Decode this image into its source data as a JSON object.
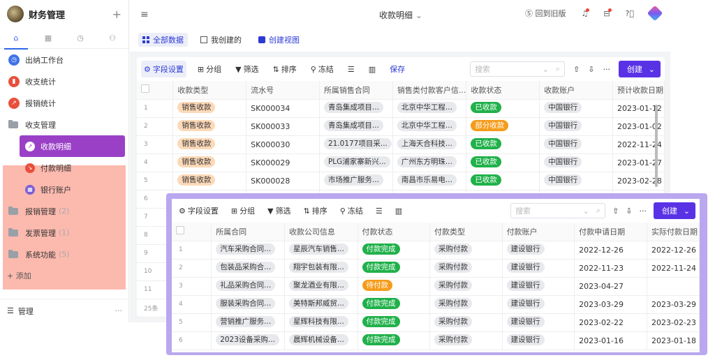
{
  "app": {
    "title": "财务管理",
    "add_icon": "plus-icon"
  },
  "sidebar_tabs": [
    {
      "name": "home-icon",
      "glyph": "⌂"
    },
    {
      "name": "table-icon",
      "glyph": "▦"
    },
    {
      "name": "clock-icon",
      "glyph": "◷"
    },
    {
      "name": "workflow-icon",
      "glyph": "⚇"
    }
  ],
  "nav": {
    "workbench": "出纳工作台",
    "income_stats": "收支统计",
    "reimburse_stats": "报销统计",
    "group_income": "收支管理",
    "receipt_detail": "收款明细",
    "payment_detail": "付款明细",
    "bank_account": "银行账户",
    "reimburse_mgmt": "报销管理",
    "reimburse_count": "(2)",
    "invoice_mgmt": "发票管理",
    "invoice_count": "(1)",
    "system": "系统功能",
    "system_count": "(5)",
    "add": "+ 添加",
    "manage": "管理",
    "more": "···"
  },
  "topbar": {
    "page_title": "收款明细",
    "back_old": "回到旧版",
    "colors": {
      "accent": "#5932e6",
      "highlight": "#fcb9ae",
      "active_nav": "#9a40c7",
      "overlay": "#b9a7ef"
    }
  },
  "views": {
    "all": "全部数据",
    "mine": "我创建的",
    "create_view": "创建视图"
  },
  "toolbar": {
    "field_settings": "字段设置",
    "group": "分组",
    "filter": "筛选",
    "sort": "排序",
    "freeze": "冻结",
    "save": "保存",
    "search_placeholder": "搜索",
    "create": "创建",
    "more": "···"
  },
  "receipts": {
    "columns": [
      "收款类型",
      "流水号",
      "所属销售合同",
      "销售类付款客户信...",
      "收款状态",
      "收款账户",
      "预计收款日期"
    ],
    "rows": [
      {
        "idx": "1",
        "type": "销售收款",
        "serial": "SK000034",
        "contract": "青岛集成项目...",
        "customer": "北京中华工程...",
        "status": "已收款",
        "status_color": "green",
        "account": "中国银行",
        "date": "2023-01-12"
      },
      {
        "idx": "2",
        "type": "销售收款",
        "serial": "SK000033",
        "contract": "青岛集成项目...",
        "customer": "北京中华工程...",
        "status": "部分收款",
        "status_color": "amber",
        "account": "中国银行",
        "date": "2023-01-02"
      },
      {
        "idx": "3",
        "type": "销售收款",
        "serial": "SK000030",
        "contract": "21.0177项目采...",
        "customer": "上海天合科技...",
        "status": "已收款",
        "status_color": "green",
        "account": "中国银行",
        "date": "2022-11-24"
      },
      {
        "idx": "4",
        "type": "销售收款",
        "serial": "SK000029",
        "contract": "PLG浦家寨新兴...",
        "customer": "广州东方明珠...",
        "status": "已收款",
        "status_color": "green",
        "account": "中国银行",
        "date": "2023-01-27"
      },
      {
        "idx": "5",
        "type": "销售收款",
        "serial": "SK000028",
        "contract": "市场推广服务...",
        "customer": "南昌市乐易电...",
        "status": "已收款",
        "status_color": "green",
        "account": "中国银行",
        "date": "2023-02-28"
      }
    ],
    "extra_indices": [
      "6",
      "7",
      "8",
      "9",
      "10",
      "11"
    ],
    "footer": "25条"
  },
  "payments": {
    "columns": [
      "所属合同",
      "收款公司信息",
      "付款状态",
      "付款类型",
      "付款账户",
      "付款申请日期",
      "实际付款日期"
    ],
    "rows": [
      {
        "idx": "1",
        "contract": "汽车采购合同...",
        "company": "星辰汽车销售...",
        "status": "付款完成",
        "status_color": "green",
        "type": "采购付款",
        "account": "建设银行",
        "apply_date": "2022-12-26",
        "actual_date": "2022-12-26"
      },
      {
        "idx": "2",
        "contract": "包装品采购合...",
        "company": "翔宇包装有限...",
        "status": "付款完成",
        "status_color": "green",
        "type": "采购付款",
        "account": "建设银行",
        "apply_date": "2022-11-23",
        "actual_date": "2022-11-24"
      },
      {
        "idx": "3",
        "contract": "礼品采购合同...",
        "company": "聚龙酒业有限...",
        "status": "待付款",
        "status_color": "amber",
        "type": "采购付款",
        "account": "建设银行",
        "apply_date": "2023-04-27",
        "actual_date": ""
      },
      {
        "idx": "4",
        "contract": "服装采购合同...",
        "company": "美特斯邦威贸...",
        "status": "付款完成",
        "status_color": "green",
        "type": "采购付款",
        "account": "建设银行",
        "apply_date": "2023-03-29",
        "actual_date": "2023-03-29"
      },
      {
        "idx": "5",
        "contract": "营销推广服务...",
        "company": "星辉科技有限...",
        "status": "付款完成",
        "status_color": "green",
        "type": "采购付款",
        "account": "建设银行",
        "apply_date": "2023-02-22",
        "actual_date": "2023-02-23"
      },
      {
        "idx": "6",
        "contract": "2023设备采购...",
        "company": "晨辉机械设备...",
        "status": "付款完成",
        "status_color": "green",
        "type": "采购付款",
        "account": "建设银行",
        "apply_date": "2023-01-16",
        "actual_date": "2023-01-18"
      }
    ]
  }
}
